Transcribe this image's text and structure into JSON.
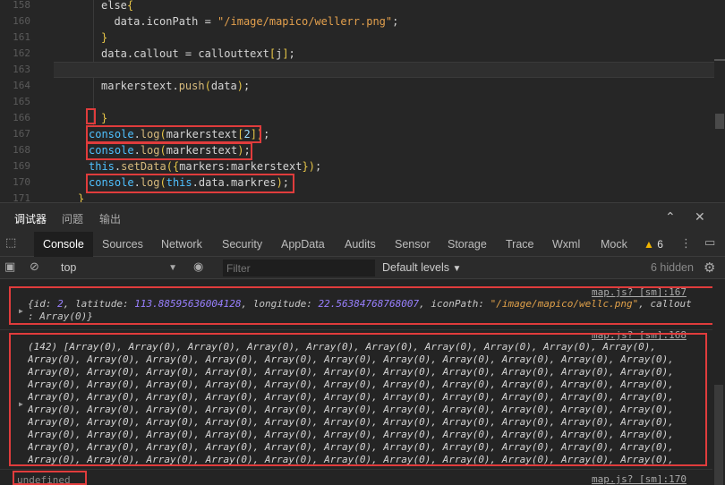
{
  "editor": {
    "lines": [
      {
        "num": "158",
        "html": "<span class='txt'>else</span><span class='brk'>{</span>"
      },
      {
        "num": "160",
        "html": "  <span class='txt'>data.iconPath = </span><span class='str'>\"/image/mapico/wellerr.png\"</span><span class='txt'>;</span>"
      },
      {
        "num": "161",
        "html": "<span class='brk'>}</span>"
      },
      {
        "num": "162",
        "html": "<span class='txt'>data.callout = callouttext</span><span class='brk'>[</span><span class='txt'>j</span><span class='brk'>]</span><span class='txt'>;</span>"
      },
      {
        "num": "163",
        "html": ""
      },
      {
        "num": "164",
        "html": "<span class='txt'>markerstext.</span><span class='fn'>push</span><span class='brk'>(</span><span class='txt'>data</span><span class='brk'>)</span><span class='txt'>;</span>"
      },
      {
        "num": "165",
        "html": ""
      },
      {
        "num": "166",
        "html": "<span class='brk'>}</span>"
      },
      {
        "num": "167",
        "html": "<span class='kw'>console</span><span class='txt'>.</span><span class='fn'>log</span><span class='brk'>(</span><span class='txt'>markerstext</span><span class='brk'>[</span><span class='blue'>2</span><span class='brk'>]</span><span class='brk'>)</span><span class='txt'>;</span>"
      },
      {
        "num": "168",
        "html": "<span class='kw'>console</span><span class='txt'>.</span><span class='fn'>log</span><span class='brk'>(</span><span class='txt'>markerstext</span><span class='brk'>)</span><span class='txt'>;</span>"
      },
      {
        "num": "169",
        "html": "<span class='kw'>this</span><span class='txt'>.</span><span class='fn'>setData</span><span class='brk'>(</span><span class='brk'>{</span><span class='txt'>markers:markerstext</span><span class='brk'>}</span><span class='brk'>)</span><span class='txt'>;</span>"
      },
      {
        "num": "170",
        "html": "<span class='kw'>console</span><span class='txt'>.</span><span class='fn'>log</span><span class='brk'>(</span><span class='kw'>this</span><span class='txt'>.data.markres</span><span class='brk'>)</span><span class='txt'>;</span>"
      },
      {
        "num": "171",
        "html": "<span class='brk'>}</span>"
      }
    ]
  },
  "panel_tabs": {
    "debugger": "调试器",
    "problems": "问题",
    "output": "输出"
  },
  "devtools_tabs": [
    "Console",
    "Sources",
    "Network",
    "Security",
    "AppData",
    "Audits",
    "Sensor",
    "Storage",
    "Trace",
    "Wxml",
    "Mock"
  ],
  "warnings_count": "6",
  "toolbar": {
    "context": "top",
    "filter_placeholder": "Filter",
    "levels": "Default levels",
    "hidden": "6 hidden"
  },
  "console": {
    "entries": [
      {
        "source": "map.js? [sm]:167"
      },
      {
        "source": "map.js? [sm]:168"
      },
      {
        "source": "map.js? [sm]:170"
      }
    ],
    "entry1_html": "<span class='key'>{id: </span><span class='num'>2</span><span class='key'>, latitude: </span><span class='num'>113.88595636004128</span><span class='key'>, longitude: </span><span class='num'>22.56384768768007</span><span class='key'>, iconPath: </span><span class='cstr'>\"/image/mapico/wellc.png\"</span><span class='key'>, callout\n: Array(0)}</span>",
    "entry2_text": "(142) [Array(0), Array(0), Array(0), Array(0), Array(0), Array(0), Array(0), Array(0), Array(0), Array(0), Array(0), Array(0), Array(0), Array(0), Array(0), Array(0), Array(0), Array(0), Array(0), Array(0), Array(0), Array(0), Array(0), Array(0), Array(0), Array(0), Array(0), Array(0), Array(0), Array(0), Array(0), Array(0), Array(0), Array(0), Array(0), Array(0), Array(0), Array(0), Array(0), Array(0), Array(0), Array(0), Array(0), Array(0), Array(0), Array(0), Array(0), Array(0), Array(0), Array(0), Array(0), Array(0), Array(0), Array(0), Array(0), Array(0), Array(0), Array(0), Array(0), Array(0), Array(0), Array(0), Array(0), Array(0), Array(0), Array(0), Array(0), Array(0), Array(0), Array(0), Array(0), Array(0), Array(0), Array(0), Array(0), Array(0), Array(0), Array(0), Array(0), Array(0), Array(0), Array(0), Array(0), Array(0), Array(0), Array(0), Array(0), Array(0), Array(0), Array(0), Array(0), Array(0), Array(0), Array(0), Array(0), Array(0), Array(0), Array(0), Array(0), Array(0), Array(0), Array(0), Array(0), Array(0), Array(0), Array(0), Array(0), Array(0), Array(0), Array(0), Array(0), Array(0), Array(0), Array(0), Array(0), Array(0), Array(0), Array(0), Array(0), Array(0), Array(0), Array(0), Array(0), Array(0), Array(0), Array(0), Array(0), Array(0), Array(0), Array(0), Array(0), Array(0), Array(0), Array(0), Array(0), …]",
    "entry3_text": "undefined"
  },
  "colors": {
    "highlight": "#e03c3c",
    "warning": "#f0b400"
  }
}
